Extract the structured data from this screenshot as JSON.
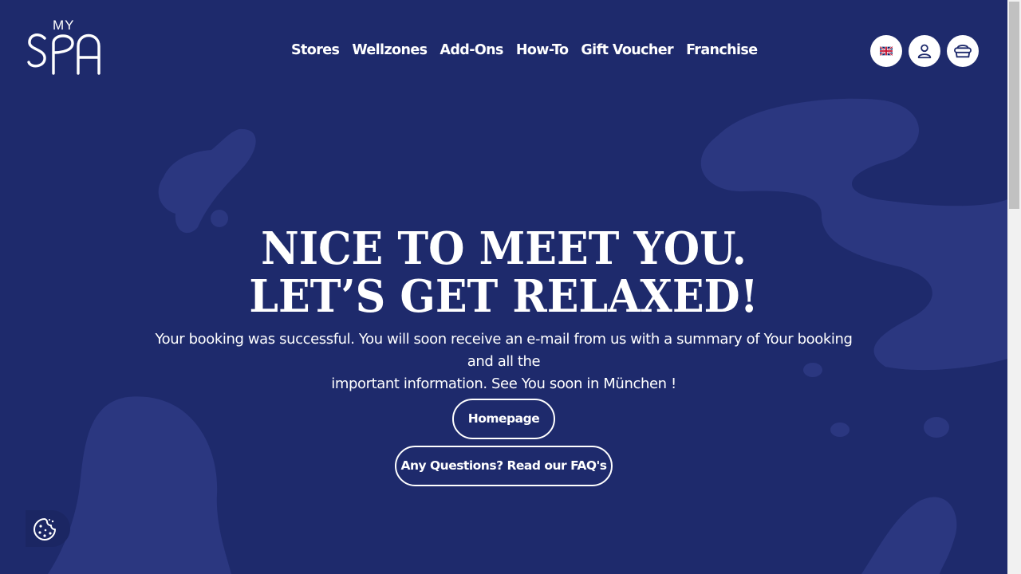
{
  "brand": {
    "logo_top": "MY",
    "logo_main": "SPA"
  },
  "nav": {
    "items": [
      {
        "label": "Stores"
      },
      {
        "label": "Wellzones"
      },
      {
        "label": "Add-Ons"
      },
      {
        "label": "How-To"
      },
      {
        "label": "Gift Voucher"
      },
      {
        "label": "Franchise"
      }
    ]
  },
  "header_icons": [
    "uk-flag-icon",
    "user-icon",
    "cart-icon"
  ],
  "hero": {
    "title_line1": "NICE TO MEET YOU.",
    "title_line2": "LET’S GET RELAXED!",
    "message_line1": "Your booking was successful. You will soon receive an e-mail from us with a summary of Your booking and all the",
    "message_line2": "important information. See You soon in München !"
  },
  "buttons": {
    "homepage": "Homepage",
    "faq": "Any Questions? Read our FAQ's"
  },
  "colors": {
    "background": "#1e2a6c",
    "blob": "#2b3780",
    "text": "#ffffff"
  },
  "cookie": {
    "icon": "cookie-icon"
  }
}
